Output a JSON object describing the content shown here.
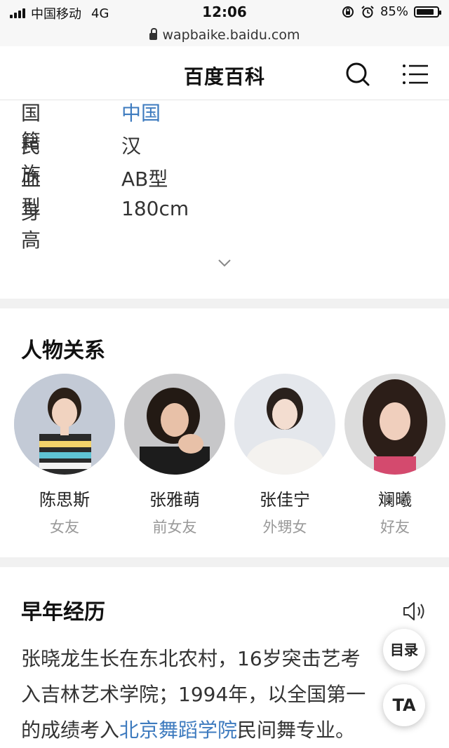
{
  "status_bar": {
    "carrier": "中国移动",
    "network": "4G",
    "time": "12:06",
    "battery": "85%",
    "battery_level": 0.85,
    "url": "wapbaike.baidu.com"
  },
  "header": {
    "title": "百度百科"
  },
  "info": [
    {
      "key": "国籍",
      "value": "中国"
    },
    {
      "key": "民族",
      "value": "汉"
    },
    {
      "key": "血型",
      "value": "AB型"
    },
    {
      "key": "身高",
      "value": "180cm"
    }
  ],
  "relations": {
    "title": "人物关系",
    "people": [
      {
        "name": "陈思斯",
        "relation": "女友"
      },
      {
        "name": "张雅萌",
        "relation": "前女友"
      },
      {
        "name": "张佳宁",
        "relation": "外甥女"
      },
      {
        "name": "斓曦",
        "relation": "好友"
      }
    ]
  },
  "early": {
    "title": "早年经历",
    "line1": "张晓龙生长在东北农村，16岁突击艺考",
    "line2": "入吉林艺术学院；1994年，以全国第一",
    "line3_pre": "的成绩考入",
    "line3_link": "北京舞蹈学院",
    "line3_post": "民间舞专业。"
  },
  "floating": {
    "toc": "目录",
    "ta": "TA"
  },
  "colors": {
    "link": "#3e7bbf",
    "separator": "#f1f1f1",
    "muted": "#999999"
  }
}
